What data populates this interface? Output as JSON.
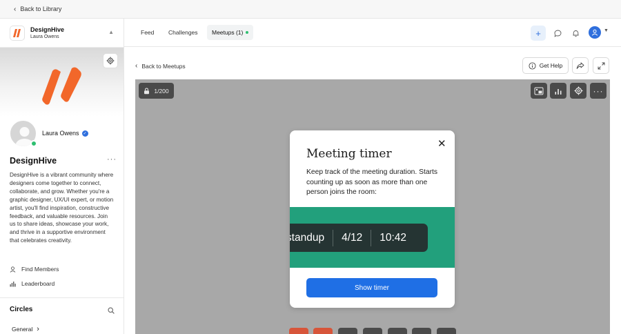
{
  "topbar": {
    "back_label": "Back to Library"
  },
  "brand": {
    "name": "DesignHive",
    "owner": "Laura Owens"
  },
  "profile": {
    "name": "Laura Owens"
  },
  "community": {
    "title": "DesignHive",
    "description": "DesignHive is a vibrant community where designers come together to connect, collaborate, and grow. Whether you're a graphic designer, UX/UI expert, or motion artist, you'll find inspiration, constructive feedback, and valuable resources. Join us to share ideas, showcase your work, and thrive in a supportive environment that celebrates creativity."
  },
  "sidebar_links": {
    "find_members": "Find Members",
    "leaderboard": "Leaderboard"
  },
  "circles": {
    "title": "Circles",
    "general": "General"
  },
  "tabs": {
    "feed": "Feed",
    "challenges": "Challenges",
    "meetups": "Meetups (1)"
  },
  "content": {
    "back_label": "Back to Meetups",
    "get_help": "Get Help"
  },
  "stage": {
    "counter": "1/200"
  },
  "modal": {
    "title": "Meeting timer",
    "description": "Keep track of the meeting duration. Starts counting up as soon as more than one person joins the room:",
    "timer_name": "y-standup",
    "timer_date": "4/12",
    "timer_time": "10:42",
    "button": "Show timer"
  },
  "colors": {
    "accent": "#1f6fe5",
    "brand_orange": "#f2672a",
    "band_green": "#22a07c",
    "online_green": "#2fbf71",
    "stage_gray": "#a8a8a8"
  }
}
